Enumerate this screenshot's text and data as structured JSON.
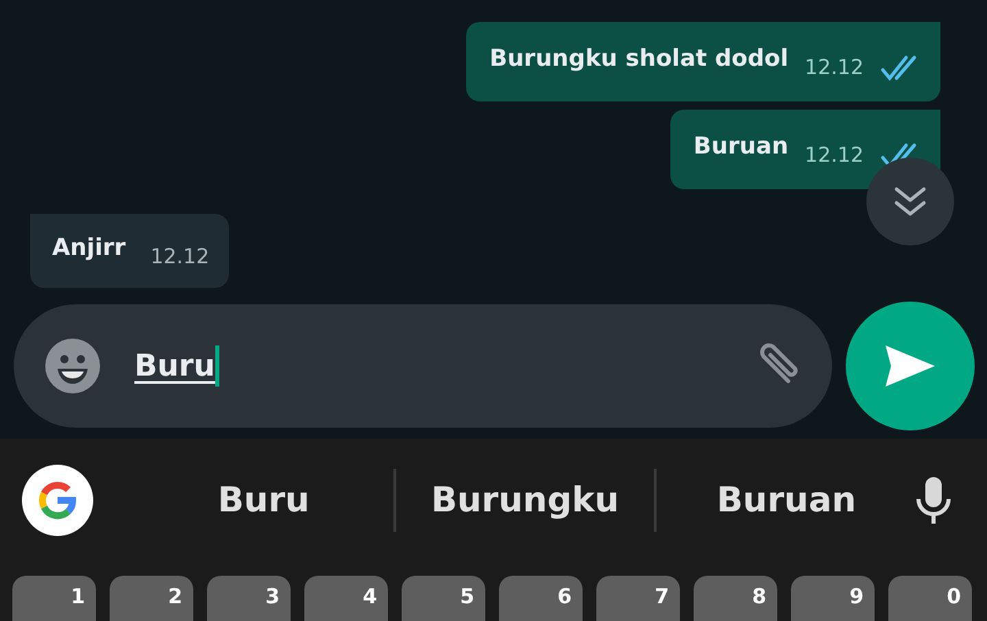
{
  "messages": [
    {
      "kind": "outgoing",
      "text": "Burungku sholat dodol",
      "time": "12.12",
      "read": true
    },
    {
      "kind": "outgoing",
      "text": "Buruan",
      "time": "12.12",
      "read": true
    },
    {
      "kind": "incoming",
      "text": "Anjirr",
      "time": "12.12"
    }
  ],
  "composer": {
    "value": "Buru"
  },
  "suggestions": [
    "Buru",
    "Burungku",
    "Buruan"
  ],
  "keys": [
    "1",
    "2",
    "3",
    "4",
    "5",
    "6",
    "7",
    "8",
    "9",
    "0"
  ]
}
